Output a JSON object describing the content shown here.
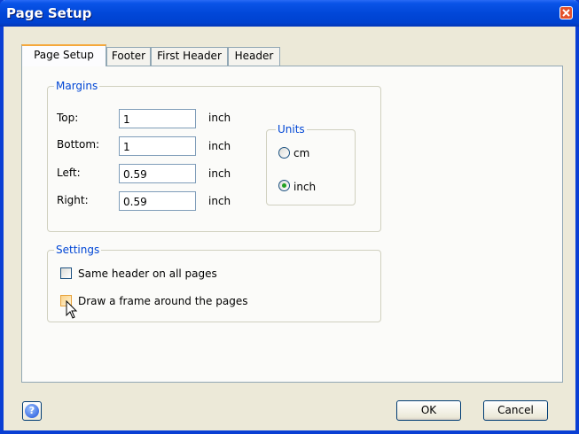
{
  "window": {
    "title": "Page Setup"
  },
  "tabs": [
    {
      "label": "Page Setup"
    },
    {
      "label": "Footer"
    },
    {
      "label": "First Header"
    },
    {
      "label": "Header"
    }
  ],
  "margins": {
    "legend": "Margins",
    "top": {
      "label": "Top:",
      "value": "1",
      "unit": "inch"
    },
    "bottom": {
      "label": "Bottom:",
      "value": "1",
      "unit": "inch"
    },
    "left": {
      "label": "Left:",
      "value": "0.59",
      "unit": "inch"
    },
    "right": {
      "label": "Right:",
      "value": "0.59",
      "unit": "inch"
    }
  },
  "units": {
    "legend": "Units",
    "options": [
      {
        "label": "cm",
        "selected": false
      },
      {
        "label": "inch",
        "selected": true
      }
    ]
  },
  "settings": {
    "legend": "Settings",
    "same_header": {
      "label": "Same header on all pages",
      "checked": false
    },
    "draw_frame": {
      "label": "Draw a frame around the pages",
      "checked": false
    }
  },
  "buttons": {
    "ok": "OK",
    "cancel": "Cancel",
    "help": "?"
  },
  "icons": {
    "close": "close-icon",
    "help": "help-icon",
    "cursor": "mouse-pointer-icon"
  }
}
